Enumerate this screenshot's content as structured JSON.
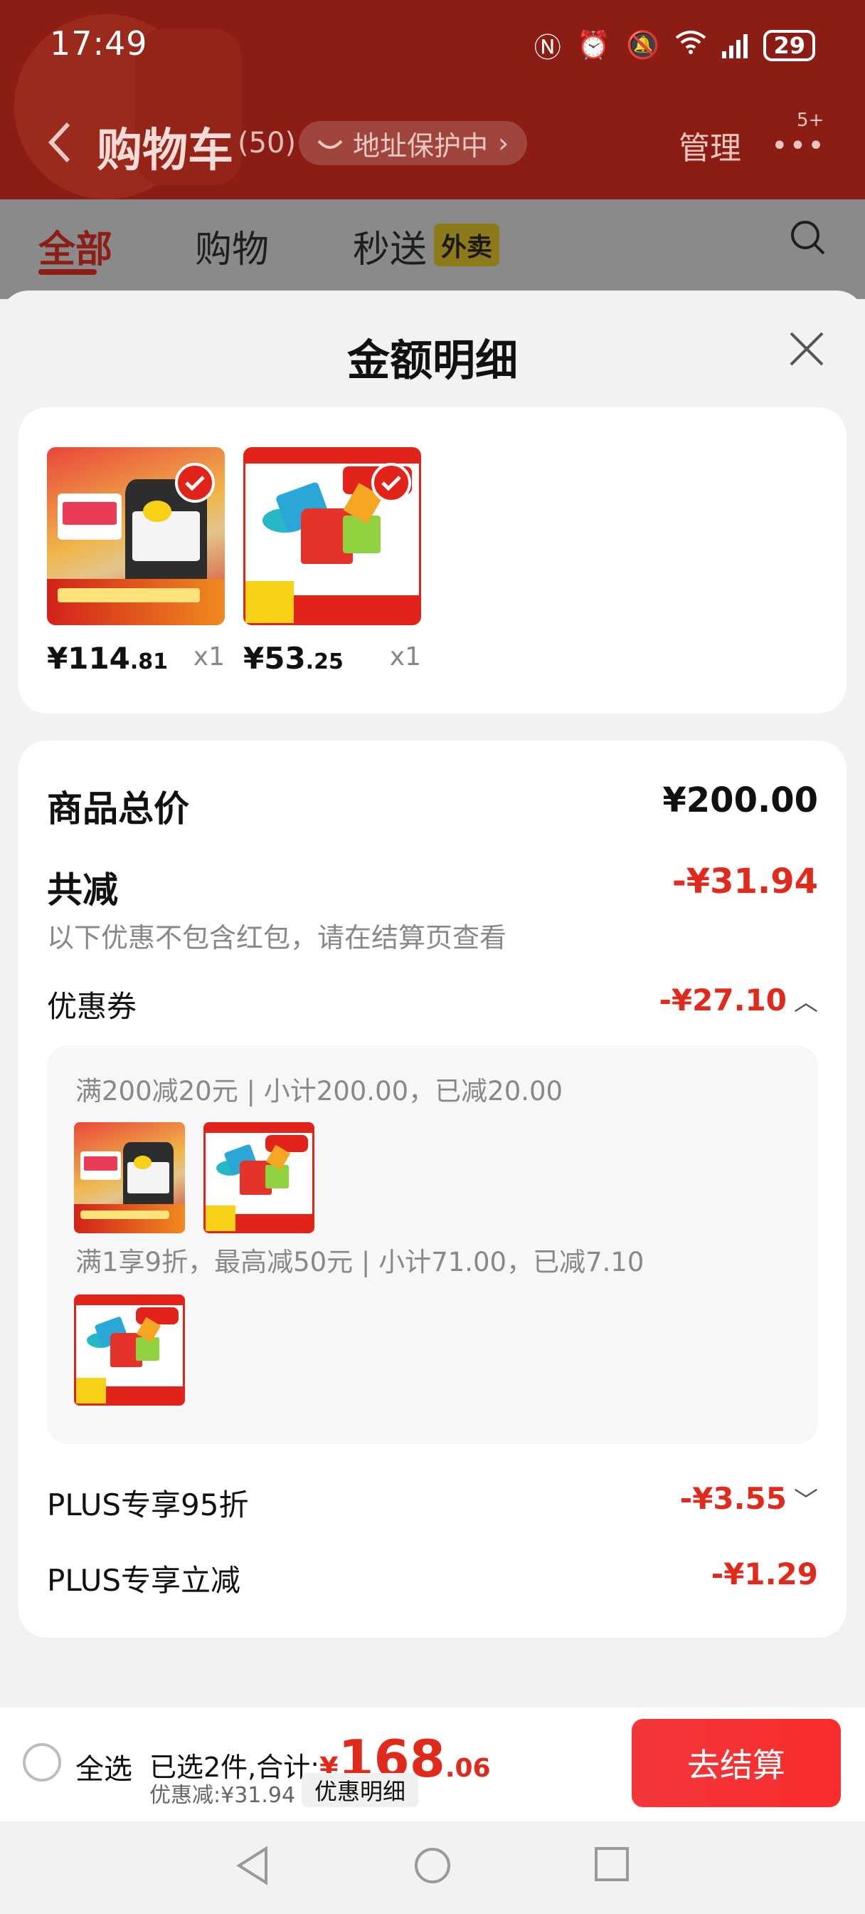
{
  "status": {
    "time": "17:49",
    "battery": "29"
  },
  "header": {
    "title": "购物车",
    "count": "(50)",
    "address_pill": "地址保护中",
    "manage": "管理",
    "more_badge": "5+"
  },
  "tabs": [
    {
      "label": "全部",
      "active": true
    },
    {
      "label": "购物"
    },
    {
      "label": "秒送"
    }
  ],
  "tab_badge": "外卖",
  "sheet": {
    "title": "金额明细",
    "products": [
      {
        "price_int": "¥114",
        "price_dec": ".81",
        "qty": "x1",
        "art": "oil"
      },
      {
        "price_int": "¥53",
        "price_dec": ".25",
        "qty": "x1",
        "art": "toy"
      }
    ],
    "total_label": "商品总价",
    "total_value": "¥200.00",
    "reduce_label": "共减",
    "reduce_value": "-¥31.94",
    "reduce_note": "以下优惠不包含红包，请在结算页查看",
    "coupon_label": "优惠券",
    "coupon_value": "-¥27.10",
    "coupon_lines": [
      "满200减20元 | 小计200.00，已减20.00",
      "满1享9折，最高减50元 | 小计71.00，已减7.10"
    ],
    "plus95_label": "PLUS专享95折",
    "plus95_value": "-¥3.55",
    "plus_cut_label": "PLUS专享立减",
    "plus_cut_value": "-¥1.29"
  },
  "checkout": {
    "select_all": "全选",
    "selected_prefix": "已选2件,合计:",
    "yen": "¥",
    "total_int": "168",
    "total_dec": ".06",
    "discount_text": "优惠减:¥31.94",
    "detail_button": "优惠明细",
    "pay_button": "去结算"
  },
  "colors": {
    "accent_red": "#e02a1c",
    "header_bg": "#8c1d14",
    "pay_button": "#f2373c"
  }
}
